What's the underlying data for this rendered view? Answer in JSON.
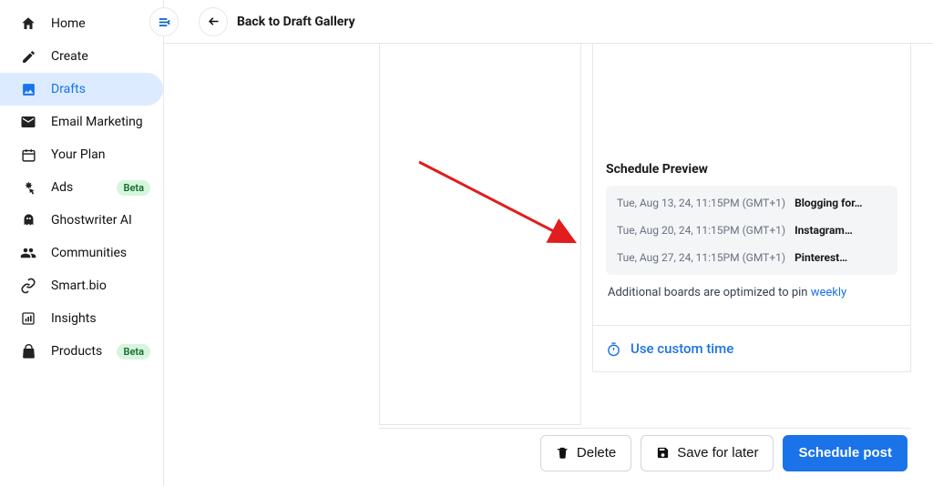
{
  "sidebar": {
    "items": [
      {
        "label": "Home"
      },
      {
        "label": "Create"
      },
      {
        "label": "Drafts"
      },
      {
        "label": "Email Marketing"
      },
      {
        "label": "Your Plan"
      },
      {
        "label": "Ads",
        "badge": "Beta"
      },
      {
        "label": "Ghostwriter AI"
      },
      {
        "label": "Communities"
      },
      {
        "label": "Smart.bio"
      },
      {
        "label": "Insights"
      },
      {
        "label": "Products",
        "badge": "Beta"
      }
    ]
  },
  "topbar": {
    "title": "Back to Draft Gallery"
  },
  "schedule": {
    "title": "Schedule Preview",
    "rows": [
      {
        "time": "Tue, Aug 13, 24, 11:15PM (GMT+1)",
        "board": "Blogging for…"
      },
      {
        "time": "Tue, Aug 20, 24, 11:15PM (GMT+1)",
        "board": "Instagram…"
      },
      {
        "time": "Tue, Aug 27, 24, 11:15PM (GMT+1)",
        "board": "Pinterest…"
      }
    ],
    "optimized_prefix": "Additional boards are optimized to pin ",
    "optimized_link": "weekly",
    "custom_time_label": "Use custom time"
  },
  "actions": {
    "delete": "Delete",
    "save": "Save for later",
    "schedule": "Schedule post"
  }
}
